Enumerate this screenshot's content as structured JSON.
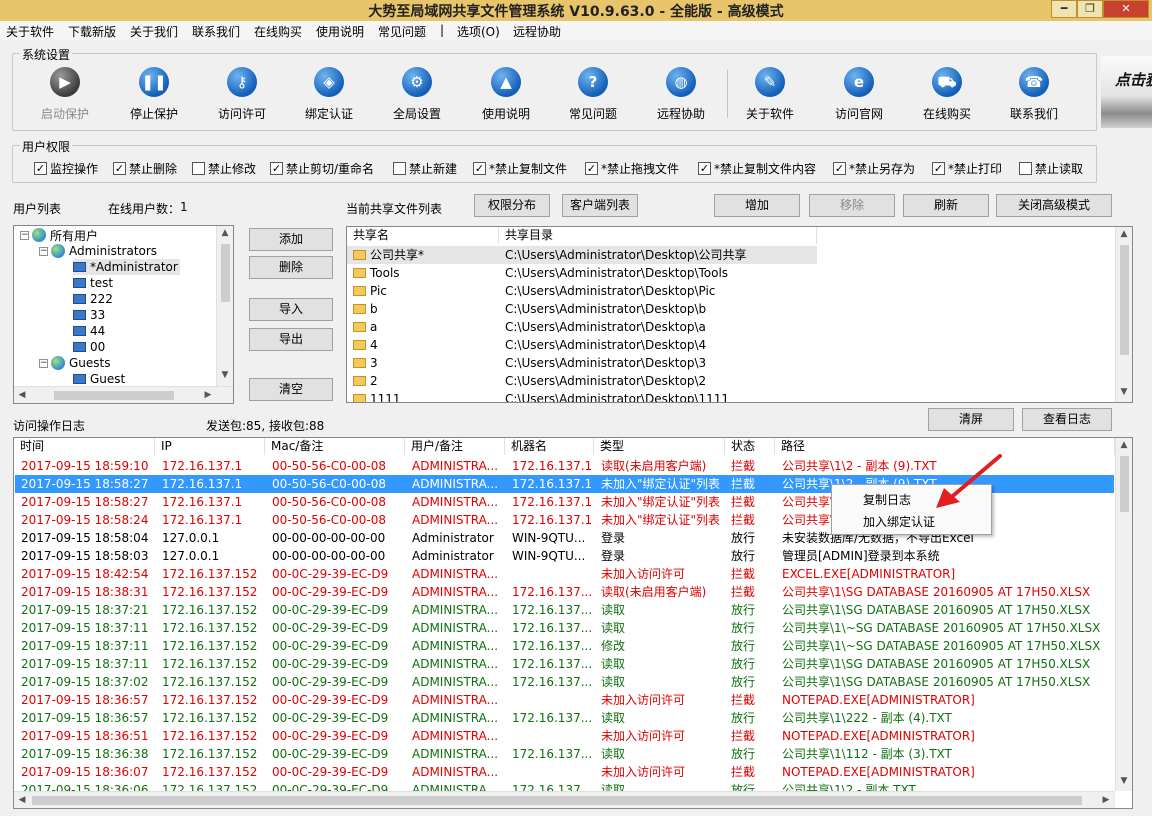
{
  "window": {
    "title": "大势至局域网共享文件管理系统 V10.9.63.0 - 全能版 - 高级模式",
    "minimize": "━",
    "restore": "❐",
    "close": "✕"
  },
  "menu": [
    {
      "label": "关于软件"
    },
    {
      "label": "下载新版"
    },
    {
      "label": "关于我们"
    },
    {
      "label": "联系我们"
    },
    {
      "label": "在线购买"
    },
    {
      "label": "使用说明"
    },
    {
      "label": "常见问题"
    },
    {
      "label": "|"
    },
    {
      "label": "选项(O)"
    },
    {
      "label": "远程协助"
    }
  ],
  "system_settings": {
    "label": "系统设置",
    "tools": [
      {
        "label": "启动保护",
        "icon": "play-icon",
        "glyph": "▶",
        "disabled": true
      },
      {
        "label": "停止保护",
        "icon": "pause-icon",
        "glyph": "❚❚",
        "disabled": false
      },
      {
        "label": "访问许可",
        "icon": "key-icon",
        "glyph": "⚷",
        "disabled": false
      },
      {
        "label": "绑定认证",
        "icon": "shield-icon",
        "glyph": "◈",
        "disabled": false
      },
      {
        "label": "全局设置",
        "icon": "gear-icon",
        "glyph": "⚙",
        "disabled": false
      },
      {
        "label": "使用说明",
        "icon": "graduation-cap-icon",
        "glyph": "▲",
        "disabled": false
      },
      {
        "label": "常见问题",
        "icon": "question-icon",
        "glyph": "?",
        "disabled": false
      },
      {
        "label": "远程协助",
        "icon": "globe-icon",
        "glyph": "◍",
        "disabled": false
      },
      {
        "label": "关于软件",
        "icon": "document-pen-icon",
        "glyph": "✎",
        "disabled": false
      },
      {
        "label": "访问官网",
        "icon": "browser-e-icon",
        "glyph": "e",
        "disabled": false
      },
      {
        "label": "在线购买",
        "icon": "cart-icon",
        "glyph": "⛟",
        "disabled": false
      },
      {
        "label": "联系我们",
        "icon": "phone-icon",
        "glyph": "☎",
        "disabled": false
      }
    ],
    "logo_text": "点击获"
  },
  "permissions": {
    "label": "用户权限",
    "items": [
      {
        "label": "监控操作",
        "checked": true
      },
      {
        "label": "禁止删除",
        "checked": true
      },
      {
        "label": "禁止修改",
        "checked": false
      },
      {
        "label": "禁止剪切/重命名",
        "checked": true
      },
      {
        "label": "禁止新建",
        "checked": false
      },
      {
        "label": "*禁止复制文件",
        "checked": true
      },
      {
        "label": "*禁止拖拽文件",
        "checked": true
      },
      {
        "label": "*禁止复制文件内容",
        "checked": true
      },
      {
        "label": "*禁止另存为",
        "checked": true
      },
      {
        "label": "*禁止打印",
        "checked": true
      },
      {
        "label": "禁止读取",
        "checked": false
      }
    ]
  },
  "users": {
    "label": "用户列表",
    "online_label": "在线用户数：",
    "online_count": "1",
    "tree": [
      {
        "label": "所有用户",
        "level": 0,
        "type": "globe",
        "toggle": "−"
      },
      {
        "label": "Administrators",
        "level": 1,
        "type": "globe",
        "toggle": "−"
      },
      {
        "label": "*Administrator",
        "level": 2,
        "type": "pc",
        "selected": true
      },
      {
        "label": "test",
        "level": 2,
        "type": "pc"
      },
      {
        "label": "222",
        "level": 2,
        "type": "pc"
      },
      {
        "label": "33",
        "level": 2,
        "type": "pc"
      },
      {
        "label": "44",
        "level": 2,
        "type": "pc"
      },
      {
        "label": "00",
        "level": 2,
        "type": "pc"
      },
      {
        "label": "Guests",
        "level": 1,
        "type": "globe",
        "toggle": "−"
      },
      {
        "label": "Guest",
        "level": 2,
        "type": "pc"
      }
    ],
    "buttons": {
      "add": "添加",
      "delete": "删除",
      "import": "导入",
      "export": "导出",
      "clear": "清空"
    }
  },
  "shares": {
    "label": "当前共享文件列表",
    "buttons": {
      "perm_dist": "权限分布",
      "client_list": "客户端列表",
      "add": "增加",
      "remove": "移除",
      "refresh": "刷新",
      "close_adv": "关闭高级模式"
    },
    "columns": [
      "共享名",
      "共享目录"
    ],
    "rows": [
      {
        "name": "公司共享*",
        "path": "C:\\Users\\Administrator\\Desktop\\公司共享",
        "selected": true
      },
      {
        "name": "Tools",
        "path": "C:\\Users\\Administrator\\Desktop\\Tools"
      },
      {
        "name": "Pic",
        "path": "C:\\Users\\Administrator\\Desktop\\Pic"
      },
      {
        "name": "b",
        "path": "C:\\Users\\Administrator\\Desktop\\b"
      },
      {
        "name": "a",
        "path": "C:\\Users\\Administrator\\Desktop\\a"
      },
      {
        "name": "4",
        "path": "C:\\Users\\Administrator\\Desktop\\4"
      },
      {
        "name": "3",
        "path": "C:\\Users\\Administrator\\Desktop\\3"
      },
      {
        "name": "2",
        "path": "C:\\Users\\Administrator\\Desktop\\2"
      },
      {
        "name": "1111",
        "path": "C:\\Users\\Administrator\\Desktop\\1111"
      }
    ]
  },
  "log": {
    "label": "访问操作日志",
    "packets": "发送包:85, 接收包:88",
    "buttons": {
      "clear": "清屏",
      "view": "查看日志"
    },
    "columns": [
      "时间",
      "IP",
      "Mac/备注",
      "用户/备注",
      "机器名",
      "类型",
      "状态",
      "路径"
    ],
    "rows": [
      {
        "time": "2017-09-15 18:59:10",
        "ip": "172.16.137.1",
        "mac": "00-50-56-C0-00-08",
        "user": "ADMINISTRA...",
        "host": "172.16.137.1",
        "type": "读取(未启用客户端)",
        "status": "拦截",
        "path": "公司共享\\1\\2 - 副本 (9).TXT",
        "color": "red"
      },
      {
        "time": "2017-09-15 18:58:27",
        "ip": "172.16.137.1",
        "mac": "00-50-56-C0-00-08",
        "user": "ADMINISTRA...",
        "host": "172.16.137.1",
        "type": "未加入\"绑定认证\"列表",
        "status": "拦截",
        "path": "公司共享\\1\\2 - 副本 (9).TXT",
        "color": "red",
        "selected": true
      },
      {
        "time": "2017-09-15 18:58:27",
        "ip": "172.16.137.1",
        "mac": "00-50-56-C0-00-08",
        "user": "ADMINISTRA...",
        "host": "172.16.137.1",
        "type": "未加入\"绑定认证\"列表",
        "status": "拦截",
        "path": "公司共享\\1\\ZONE.IDENTIFIER",
        "color": "red"
      },
      {
        "time": "2017-09-15 18:58:24",
        "ip": "172.16.137.1",
        "mac": "00-50-56-C0-00-08",
        "user": "ADMINISTRA...",
        "host": "172.16.137.1",
        "type": "未加入\"绑定认证\"列表",
        "status": "拦截",
        "path": "公司共享\\1",
        "color": "red"
      },
      {
        "time": "2017-09-15 18:58:04",
        "ip": "127.0.0.1",
        "mac": "00-00-00-00-00-00",
        "user": "Administrator",
        "host": "WIN-9QTU...",
        "type": "登录",
        "status": "放行",
        "path": "未安装数据库/无数据，不导出Excel",
        "color": "black"
      },
      {
        "time": "2017-09-15 18:58:03",
        "ip": "127.0.0.1",
        "mac": "00-00-00-00-00-00",
        "user": "Administrator",
        "host": "WIN-9QTU...",
        "type": "登录",
        "status": "放行",
        "path": "管理员[ADMIN]登录到本系统",
        "color": "black"
      },
      {
        "time": "2017-09-15 18:42:54",
        "ip": "172.16.137.152",
        "mac": "00-0C-29-39-EC-D9",
        "user": "ADMINISTRA...",
        "host": "",
        "type": "未加入访问许可",
        "status": "拦截",
        "path": "EXCEL.EXE[ADMINISTRATOR]",
        "color": "red"
      },
      {
        "time": "2017-09-15 18:38:31",
        "ip": "172.16.137.152",
        "mac": "00-0C-29-39-EC-D9",
        "user": "ADMINISTRA...",
        "host": "172.16.137...",
        "type": "读取(未启用客户端)",
        "status": "拦截",
        "path": "公司共享\\1\\SG DATABASE 20160905 AT 17H50.XLSX",
        "color": "red"
      },
      {
        "time": "2017-09-15 18:37:21",
        "ip": "172.16.137.152",
        "mac": "00-0C-29-39-EC-D9",
        "user": "ADMINISTRA...",
        "host": "172.16.137...",
        "type": "读取",
        "status": "放行",
        "path": "公司共享\\1\\SG DATABASE 20160905 AT 17H50.XLSX",
        "color": "green"
      },
      {
        "time": "2017-09-15 18:37:11",
        "ip": "172.16.137.152",
        "mac": "00-0C-29-39-EC-D9",
        "user": "ADMINISTRA...",
        "host": "172.16.137...",
        "type": "读取",
        "status": "放行",
        "path": "公司共享\\1\\~SG DATABASE 20160905 AT 17H50.XLSX",
        "color": "green"
      },
      {
        "time": "2017-09-15 18:37:11",
        "ip": "172.16.137.152",
        "mac": "00-0C-29-39-EC-D9",
        "user": "ADMINISTRA...",
        "host": "172.16.137...",
        "type": "修改",
        "status": "放行",
        "path": "公司共享\\1\\~SG DATABASE 20160905 AT 17H50.XLSX",
        "color": "green"
      },
      {
        "time": "2017-09-15 18:37:11",
        "ip": "172.16.137.152",
        "mac": "00-0C-29-39-EC-D9",
        "user": "ADMINISTRA...",
        "host": "172.16.137...",
        "type": "读取",
        "status": "放行",
        "path": "公司共享\\1\\SG DATABASE 20160905 AT 17H50.XLSX",
        "color": "green"
      },
      {
        "time": "2017-09-15 18:37:02",
        "ip": "172.16.137.152",
        "mac": "00-0C-29-39-EC-D9",
        "user": "ADMINISTRA...",
        "host": "172.16.137...",
        "type": "读取",
        "status": "放行",
        "path": "公司共享\\1\\SG DATABASE 20160905 AT 17H50.XLSX",
        "color": "green"
      },
      {
        "time": "2017-09-15 18:36:57",
        "ip": "172.16.137.152",
        "mac": "00-0C-29-39-EC-D9",
        "user": "ADMINISTRA...",
        "host": "",
        "type": "未加入访问许可",
        "status": "拦截",
        "path": "NOTEPAD.EXE[ADMINISTRATOR]",
        "color": "red"
      },
      {
        "time": "2017-09-15 18:36:57",
        "ip": "172.16.137.152",
        "mac": "00-0C-29-39-EC-D9",
        "user": "ADMINISTRA...",
        "host": "172.16.137...",
        "type": "读取",
        "status": "放行",
        "path": "公司共享\\1\\222 - 副本 (4).TXT",
        "color": "green"
      },
      {
        "time": "2017-09-15 18:36:51",
        "ip": "172.16.137.152",
        "mac": "00-0C-29-39-EC-D9",
        "user": "ADMINISTRA...",
        "host": "",
        "type": "未加入访问许可",
        "status": "拦截",
        "path": "NOTEPAD.EXE[ADMINISTRATOR]",
        "color": "red"
      },
      {
        "time": "2017-09-15 18:36:38",
        "ip": "172.16.137.152",
        "mac": "00-0C-29-39-EC-D9",
        "user": "ADMINISTRA...",
        "host": "172.16.137...",
        "type": "读取",
        "status": "放行",
        "path": "公司共享\\1\\112 - 副本 (3).TXT",
        "color": "green"
      },
      {
        "time": "2017-09-15 18:36:07",
        "ip": "172.16.137.152",
        "mac": "00-0C-29-39-EC-D9",
        "user": "ADMINISTRA...",
        "host": "",
        "type": "未加入访问许可",
        "status": "拦截",
        "path": "NOTEPAD.EXE[ADMINISTRATOR]",
        "color": "red"
      },
      {
        "time": "2017-09-15 18:36:06",
        "ip": "172.16.137.152",
        "mac": "00-0C-29-39-EC-D9",
        "user": "ADMINISTRA...",
        "host": "172.16.137...",
        "type": "读取",
        "status": "放行",
        "path": "公司共享\\1\\2 - 副本.TXT",
        "color": "green"
      }
    ]
  },
  "context_menu": {
    "items": [
      "复制日志",
      "加入绑定认证"
    ],
    "arrow_color": "#e02020"
  },
  "colors": {
    "red": "#e00000",
    "green": "#107010",
    "black": "#000000",
    "selection": "#3399ff",
    "titlebar": "#e8c56a"
  }
}
